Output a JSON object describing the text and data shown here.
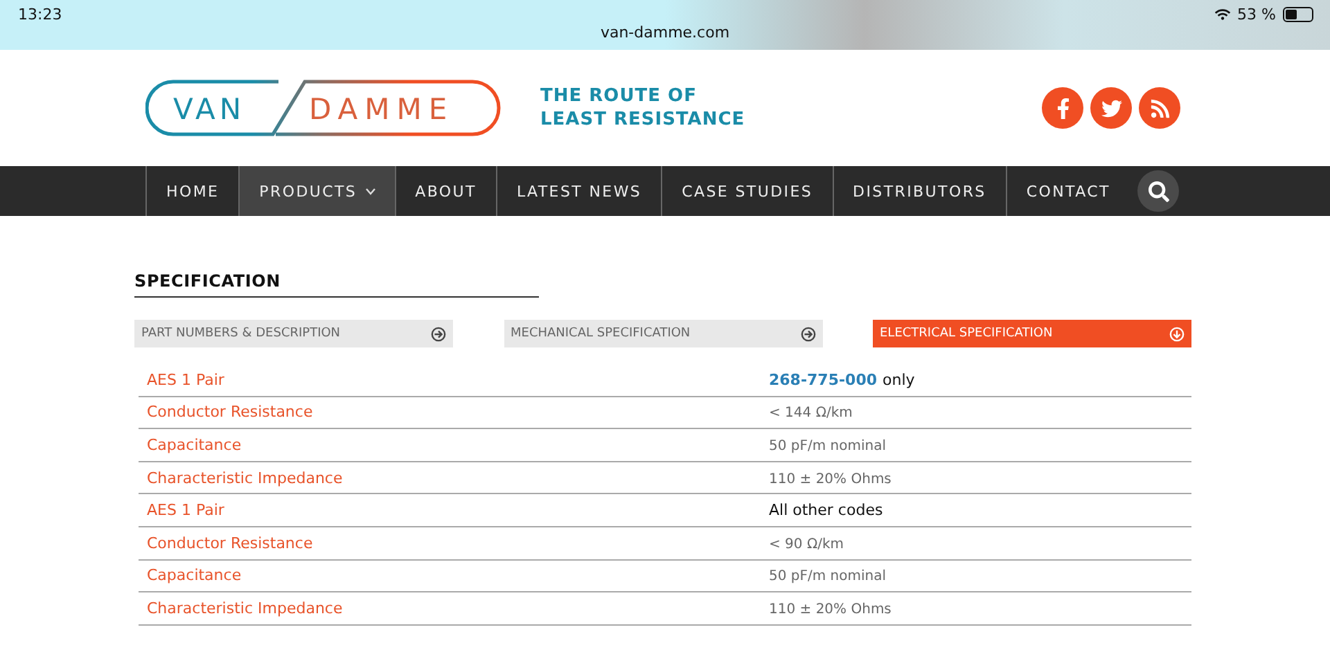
{
  "status_bar": {
    "time": "13:23",
    "url": "van-damme.com",
    "battery": "53 %"
  },
  "logo": {
    "left": "VAN",
    "right": "DAMME",
    "tagline": [
      "THE ROUTE OF",
      "LEAST RESISTANCE"
    ]
  },
  "social": [
    {
      "kind": "facebook"
    },
    {
      "kind": "twitter"
    },
    {
      "kind": "rss"
    }
  ],
  "nav": [
    {
      "label": "HOME",
      "selected": false,
      "dropdown": false
    },
    {
      "label": "PRODUCTS",
      "selected": true,
      "dropdown": true
    },
    {
      "label": "ABOUT",
      "selected": false,
      "dropdown": false
    },
    {
      "label": "LATEST NEWS",
      "selected": false,
      "dropdown": false
    },
    {
      "label": "CASE STUDIES",
      "selected": false,
      "dropdown": false
    },
    {
      "label": "DISTRIBUTORS",
      "selected": false,
      "dropdown": false
    },
    {
      "label": "CONTACT",
      "selected": false,
      "dropdown": false
    }
  ],
  "section_title": "SPECIFICATION",
  "tabs": [
    {
      "label": "PART NUMBERS & DESCRIPTION",
      "selected": false
    },
    {
      "label": "MECHANICAL SPECIFICATION",
      "selected": false
    },
    {
      "label": "ELECTRICAL SPECIFICATION",
      "selected": true
    }
  ],
  "rows": [
    {
      "label": "AES 1 Pair",
      "kind": "heading",
      "link": "268-775-000",
      "value": "only"
    },
    {
      "label": "Conductor Resistance",
      "kind": "plain",
      "value": "< 144 Ω/km"
    },
    {
      "label": "Capacitance",
      "kind": "plain",
      "value": "50 pF/m nominal"
    },
    {
      "label": "Characteristic Impedance",
      "kind": "plain",
      "value": "110 ± 20% Ohms"
    },
    {
      "label": "AES 1 Pair",
      "kind": "heading",
      "value": "All other codes"
    },
    {
      "label": "Conductor Resistance",
      "kind": "plain",
      "value": "< 90 Ω/km"
    },
    {
      "label": "Capacitance",
      "kind": "plain",
      "value": "50 pF/m nominal"
    },
    {
      "label": "Characteristic Impedance",
      "kind": "plain",
      "value": "110 ± 20% Ohms"
    }
  ]
}
